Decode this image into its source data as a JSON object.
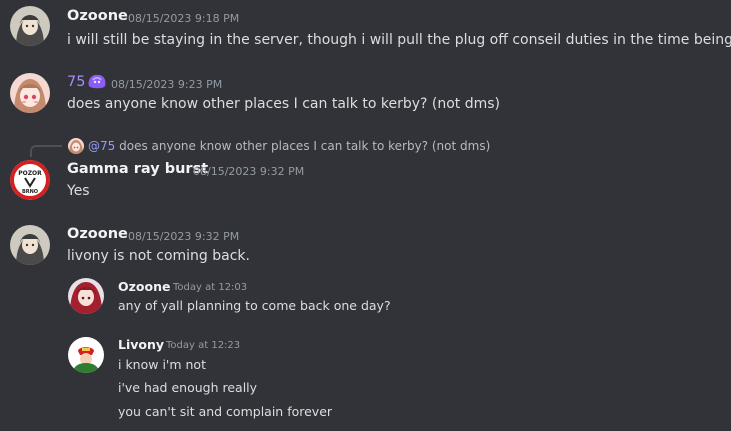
{
  "colors": {
    "background": "#313338",
    "username": "#f2f3f5",
    "username_75": "#a78bfa",
    "timestamp": "#949ba4",
    "message": "#dbdee1",
    "mention": "#949cf7"
  },
  "messages": [
    {
      "author": "Ozoone",
      "timestamp": "08/15/2023 9:18 PM",
      "text": "i will still be staying in the server, though i will pull the plug off conseil duties in the time being",
      "avatar_icon": "anime-girl-avatar"
    },
    {
      "author": "75",
      "badge_icon": "purple-blob-emoji-icon",
      "timestamp": "08/15/2023 9:23 PM",
      "text": "does anyone know other places I can talk to kerby? (not dms)",
      "avatar_icon": "pink-hair-avatar"
    },
    {
      "reply": {
        "mention": "@75",
        "text": "does anyone know other places I can talk to kerby? (not dms)"
      },
      "author": "Gamma ray burst",
      "timestamp": "08/15/2023 9:32 PM",
      "text": "Yes",
      "avatar_icon": "pozor-brno-badge-avatar",
      "avatar_text_top": "POZOR",
      "avatar_text_bottom": "BRNO"
    },
    {
      "author": "Ozoone",
      "timestamp": "08/15/2023 9:32 PM",
      "text": "livony is not coming back.",
      "avatar_icon": "anime-girl-avatar"
    }
  ],
  "embedded": [
    {
      "author": "Ozoone",
      "timestamp": "Today at 12:03",
      "lines": [
        "any of yall planning to come back one day?"
      ],
      "avatar_icon": "red-hair-avatar"
    },
    {
      "author": "Livony",
      "timestamp": "Today at 12:23",
      "lines": [
        "i know i'm not",
        "i've had enough really",
        "you can't sit and complain forever"
      ],
      "avatar_icon": "livony-flag-avatar"
    }
  ]
}
